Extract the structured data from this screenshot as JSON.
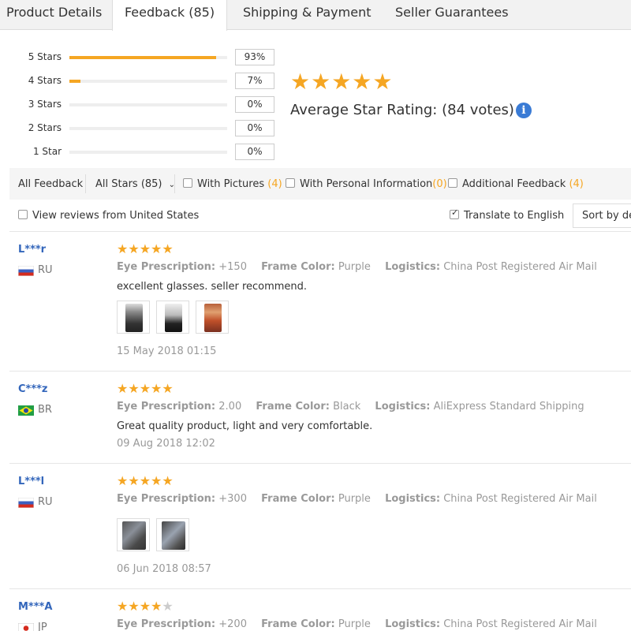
{
  "tabs": [
    {
      "label": "Product Details"
    },
    {
      "label": "Feedback (85)"
    },
    {
      "label": "Shipping & Payment"
    },
    {
      "label": "Seller Guarantees"
    }
  ],
  "ratings": [
    {
      "label": "5 Stars",
      "pct": "93%",
      "fill": 0.93
    },
    {
      "label": "4 Stars",
      "pct": "7%",
      "fill": 0.07
    },
    {
      "label": "3 Stars",
      "pct": "0%",
      "fill": 0
    },
    {
      "label": "2 Stars",
      "pct": "0%",
      "fill": 0
    },
    {
      "label": "1 Star",
      "pct": "0%",
      "fill": 0
    }
  ],
  "summary": {
    "stars": "★★★★★",
    "avg_label": "Average Star Rating:",
    "votes": "(84 votes)",
    "info": "i"
  },
  "filters": {
    "all_feedback": "All Feedback",
    "all_stars": "All Stars (85)",
    "with_pictures": "With Pictures",
    "with_pictures_count": "(4)",
    "with_personal": "With Personal Information",
    "with_personal_count": "(0)",
    "additional": "Additional Feedback",
    "additional_count": "(4)",
    "view_us": "View reviews from United States",
    "translate": "Translate to English",
    "sort": "Sort by def"
  },
  "meta_labels": {
    "prescription": "Eye Prescription:",
    "frame": "Frame Color:",
    "logistics": "Logistics:"
  },
  "reviews": [
    {
      "user": "L***r",
      "country": "RU",
      "stars": 5,
      "prescription": "+150",
      "frame": "Purple",
      "logistics": "China Post Registered Air Mail",
      "text": "excellent glasses. seller recommend.",
      "date": "15 May 2018 01:15"
    },
    {
      "user": "C***z",
      "country": "BR",
      "stars": 5,
      "prescription": "2.00",
      "frame": "Black",
      "logistics": "AliExpress Standard Shipping",
      "text": "Great quality product, light and very comfortable.",
      "date": "09 Aug 2018 12:02"
    },
    {
      "user": "L***l",
      "country": "RU",
      "stars": 5,
      "prescription": "+300",
      "frame": "Purple",
      "logistics": "China Post Registered Air Mail",
      "text": "",
      "date": "06 Jun 2018 08:57"
    },
    {
      "user": "M***A",
      "country": "JP",
      "stars": 4,
      "prescription": "+200",
      "frame": "Purple",
      "logistics": "China Post Registered Air Mail",
      "text": "",
      "date": ""
    }
  ],
  "colors": {
    "accent": "#f5a623",
    "link": "#3366bb",
    "info": "#3a7bd5"
  }
}
